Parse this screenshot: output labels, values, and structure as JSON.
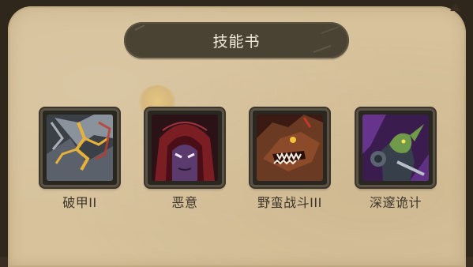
{
  "panel": {
    "title": "技能书"
  },
  "skills": [
    {
      "label": "破甲II",
      "icon": "armor-break-icon"
    },
    {
      "label": "恶意",
      "icon": "hooded-figure-icon"
    },
    {
      "label": "野蛮战斗III",
      "icon": "werewolf-icon"
    },
    {
      "label": "深邃诡计",
      "icon": "goblin-rogue-icon"
    }
  ],
  "colors": {
    "panel_bg": "#d7c29b",
    "banner_bg": "#4a4334",
    "title_text": "#f1ead8",
    "label_text": "#3d3429"
  }
}
